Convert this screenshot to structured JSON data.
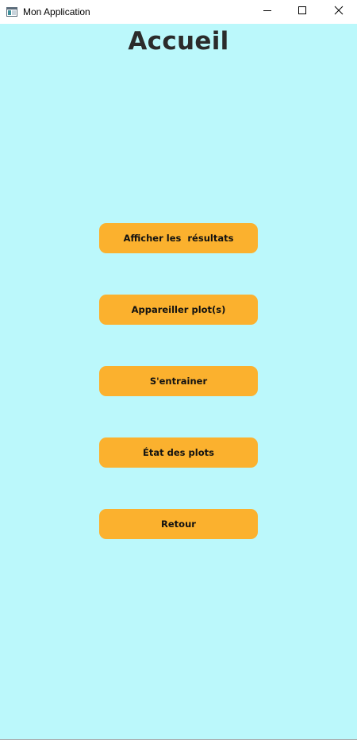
{
  "window": {
    "title": "Mon Application",
    "controls": {
      "minimize": "minimize-icon",
      "maximize": "maximize-icon",
      "close": "close-icon"
    }
  },
  "page": {
    "title": "Accueil",
    "background_color": "#bbf8fb",
    "button_color": "#fbb12e"
  },
  "menu": {
    "items": [
      {
        "label": "Afficher les  résultats"
      },
      {
        "label": "Appareiller plot(s)"
      },
      {
        "label": "S'entrainer"
      },
      {
        "label": "État des plots"
      },
      {
        "label": "Retour"
      }
    ]
  }
}
